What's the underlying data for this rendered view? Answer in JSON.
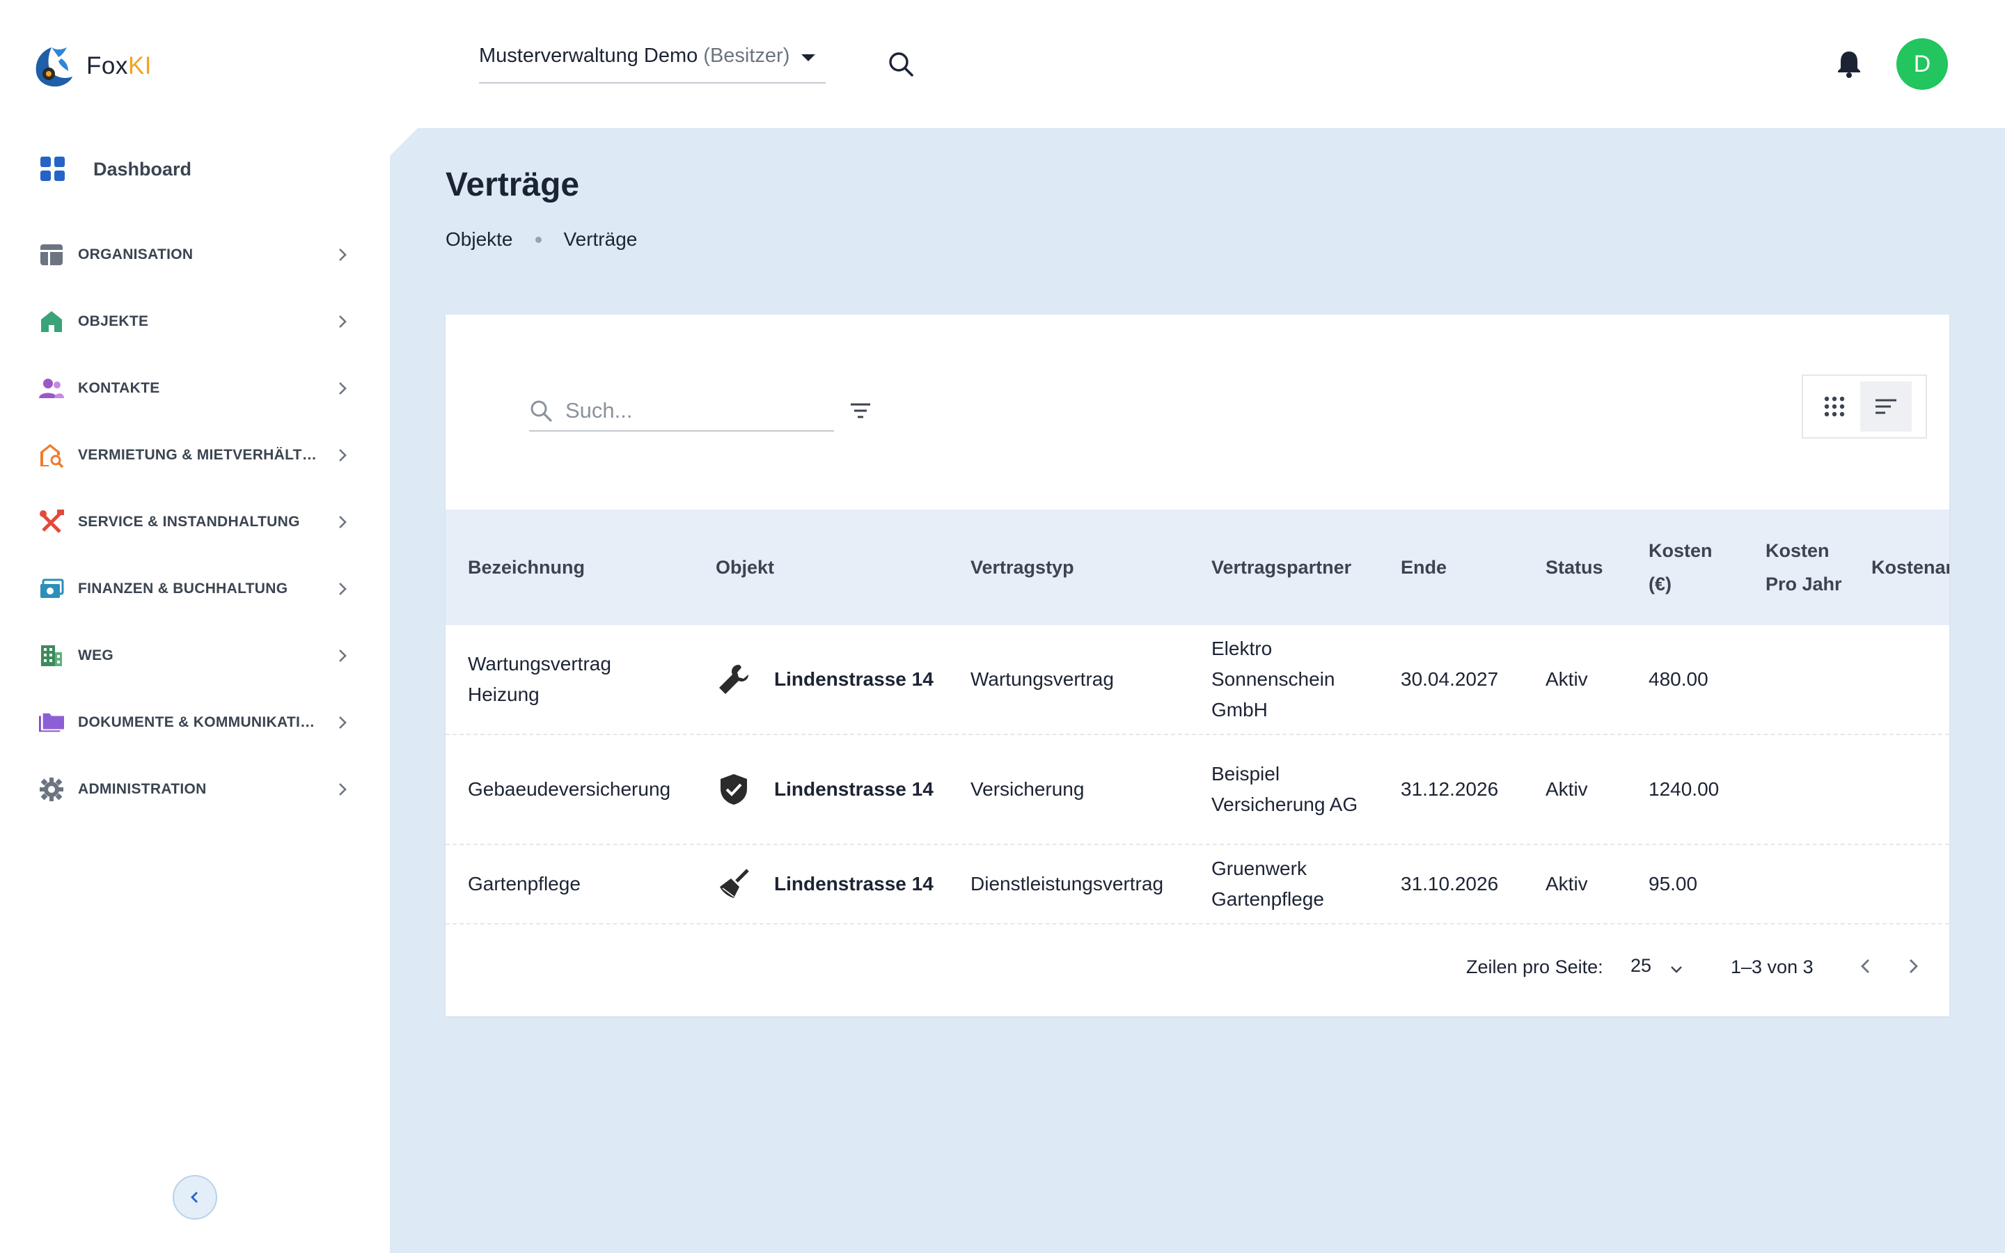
{
  "app": {
    "name_prefix": "Fox",
    "name_suffix": "KI"
  },
  "colors": {
    "accent_green": "#22c55e",
    "logo_orange": "#f2a51a",
    "main_bg": "#dde9f5",
    "nav_blue": "#2563c9"
  },
  "header": {
    "org_name": "Musterverwaltung Demo",
    "org_role": "(Besitzer)",
    "avatar_letter": "D"
  },
  "sidebar": {
    "dashboard": "Dashboard",
    "items": [
      {
        "label": "ORGANISATION",
        "icon": "layout-icon"
      },
      {
        "label": "OBJEKTE",
        "icon": "home-icon"
      },
      {
        "label": "KONTAKTE",
        "icon": "people-icon"
      },
      {
        "label": "VERMIETUNG & MIETVERHÄLTN...",
        "icon": "house-search-icon"
      },
      {
        "label": "SERVICE & INSTANDHALTUNG",
        "icon": "tools-icon"
      },
      {
        "label": "FINANZEN & BUCHHALTUNG",
        "icon": "money-icon"
      },
      {
        "label": "WEG",
        "icon": "building-icon"
      },
      {
        "label": "DOKUMENTE & KOMMUNIKATION",
        "icon": "folder-icon"
      },
      {
        "label": "ADMINISTRATION",
        "icon": "gear-icon"
      }
    ]
  },
  "page": {
    "title": "Verträge",
    "breadcrumb": [
      "Objekte",
      "Verträge"
    ]
  },
  "search": {
    "placeholder": "Such..."
  },
  "table": {
    "columns": [
      "Bezeichnung",
      "Objekt",
      "Vertragstyp",
      "Vertragspartner",
      "Ende",
      "Status",
      "Kosten (€)",
      "Kosten Pro Jahr",
      "Kostenart"
    ],
    "rows": [
      {
        "bezeichnung": "Wartungsvertrag Heizung",
        "icon": "wrench-icon",
        "objekt": "Lindenstrasse 14",
        "typ": "Wartungsvertrag",
        "partner": "Elektro Sonnenschein GmbH",
        "ende": "30.04.2027",
        "status": "Aktiv",
        "kosten": "480.00"
      },
      {
        "bezeichnung": "Gebaeudeversicherung",
        "icon": "shield-check-icon",
        "objekt": "Lindenstrasse 14",
        "typ": "Versicherung",
        "partner": "Beispiel Versicherung AG",
        "ende": "31.12.2026",
        "status": "Aktiv",
        "kosten": "1240.00"
      },
      {
        "bezeichnung": "Gartenpflege",
        "icon": "broom-icon",
        "objekt": "Lindenstrasse 14",
        "typ": "Dienstleistungsvertrag",
        "partner": "Gruenwerk Gartenpflege",
        "ende": "31.10.2026",
        "status": "Aktiv",
        "kosten": "95.00"
      }
    ]
  },
  "pagination": {
    "rows_per_page_label": "Zeilen pro Seite:",
    "rows_per_page": "25",
    "range": "1–3 von 3"
  }
}
